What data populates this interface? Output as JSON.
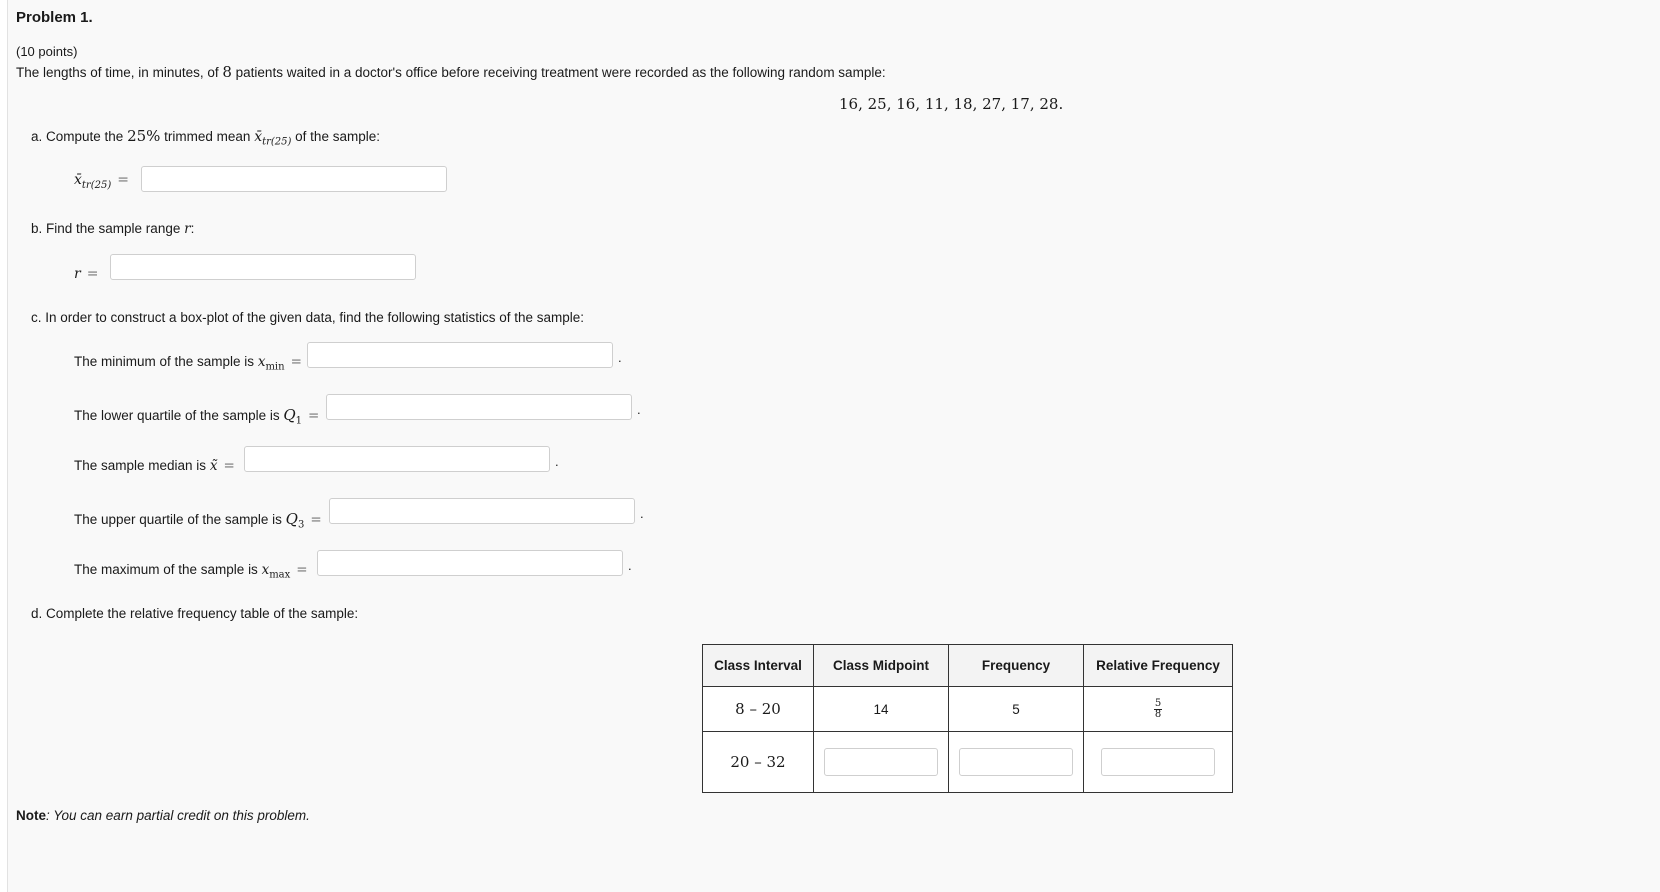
{
  "problem": {
    "title": "Problem 1.",
    "points": "(10 points)",
    "statement_pre": "The lengths of time, in minutes, of ",
    "statement_n": "8",
    "statement_post": " patients waited in a doctor's office before receiving treatment were recorded as the following random sample:",
    "sample_data": "16,  25,  16,  11,  18,  27,  17,  28."
  },
  "part_a": {
    "prefix": "a. Compute the ",
    "percent": "25%",
    "middle": " trimmed mean ",
    "symbol": "x̄",
    "subscript": "tr(25)",
    "suffix": " of the sample:",
    "answer_label_symbol": "x̄",
    "answer_label_subscript": "tr(25)",
    "equals": "=",
    "answer_value": ""
  },
  "part_b": {
    "prefix": "b. Find the sample range ",
    "symbol": "r",
    "suffix": ":",
    "answer_label": "r",
    "equals": "=",
    "answer_value": ""
  },
  "part_c": {
    "label": "c. In order to construct a box-plot of the given data, find the following statistics of the sample:",
    "items": [
      {
        "text": "The minimum of the sample is ",
        "symbol": "x",
        "sub": "min",
        "equals": "=",
        "value": "",
        "period": "."
      },
      {
        "text": "The lower quartile of the sample is ",
        "symbol": "Q",
        "sub": "1",
        "equals": "=",
        "value": "",
        "period": "."
      },
      {
        "text": "The sample median is ",
        "symbol": "x̃",
        "sub": "",
        "equals": "=",
        "value": "",
        "period": "."
      },
      {
        "text": "The upper quartile of the sample is ",
        "symbol": "Q",
        "sub": "3",
        "equals": "=",
        "value": "",
        "period": "."
      },
      {
        "text": "The maximum of the sample is ",
        "symbol": "x",
        "sub": "max",
        "equals": "=",
        "value": "",
        "period": "."
      }
    ]
  },
  "part_d": {
    "label": "d. Complete the relative frequency table of the sample:",
    "headers": [
      "Class Interval",
      "Class Midpoint",
      "Frequency",
      "Relative Frequency"
    ],
    "rows": [
      {
        "interval": "8 – 20",
        "midpoint": "14",
        "frequency": "5",
        "rel_num": "5",
        "rel_den": "8"
      },
      {
        "interval": "20 – 32",
        "midpoint": "",
        "frequency": "",
        "rel": ""
      }
    ]
  },
  "note": {
    "lead": "Note",
    "text": ": You can earn partial credit on this problem."
  }
}
